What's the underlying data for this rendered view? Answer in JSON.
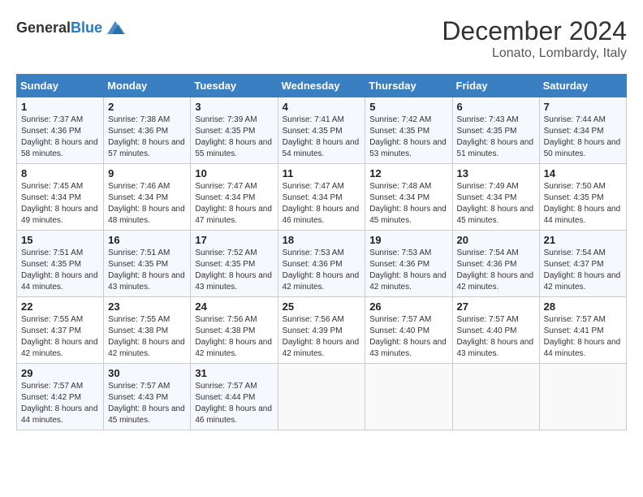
{
  "header": {
    "logo_general": "General",
    "logo_blue": "Blue",
    "month": "December 2024",
    "location": "Lonato, Lombardy, Italy"
  },
  "weekdays": [
    "Sunday",
    "Monday",
    "Tuesday",
    "Wednesday",
    "Thursday",
    "Friday",
    "Saturday"
  ],
  "weeks": [
    [
      {
        "day": "1",
        "sunrise": "7:37 AM",
        "sunset": "4:36 PM",
        "daylight": "8 hours and 58 minutes."
      },
      {
        "day": "2",
        "sunrise": "7:38 AM",
        "sunset": "4:36 PM",
        "daylight": "8 hours and 57 minutes."
      },
      {
        "day": "3",
        "sunrise": "7:39 AM",
        "sunset": "4:35 PM",
        "daylight": "8 hours and 55 minutes."
      },
      {
        "day": "4",
        "sunrise": "7:41 AM",
        "sunset": "4:35 PM",
        "daylight": "8 hours and 54 minutes."
      },
      {
        "day": "5",
        "sunrise": "7:42 AM",
        "sunset": "4:35 PM",
        "daylight": "8 hours and 53 minutes."
      },
      {
        "day": "6",
        "sunrise": "7:43 AM",
        "sunset": "4:35 PM",
        "daylight": "8 hours and 51 minutes."
      },
      {
        "day": "7",
        "sunrise": "7:44 AM",
        "sunset": "4:34 PM",
        "daylight": "8 hours and 50 minutes."
      }
    ],
    [
      {
        "day": "8",
        "sunrise": "7:45 AM",
        "sunset": "4:34 PM",
        "daylight": "8 hours and 49 minutes."
      },
      {
        "day": "9",
        "sunrise": "7:46 AM",
        "sunset": "4:34 PM",
        "daylight": "8 hours and 48 minutes."
      },
      {
        "day": "10",
        "sunrise": "7:47 AM",
        "sunset": "4:34 PM",
        "daylight": "8 hours and 47 minutes."
      },
      {
        "day": "11",
        "sunrise": "7:47 AM",
        "sunset": "4:34 PM",
        "daylight": "8 hours and 46 minutes."
      },
      {
        "day": "12",
        "sunrise": "7:48 AM",
        "sunset": "4:34 PM",
        "daylight": "8 hours and 45 minutes."
      },
      {
        "day": "13",
        "sunrise": "7:49 AM",
        "sunset": "4:34 PM",
        "daylight": "8 hours and 45 minutes."
      },
      {
        "day": "14",
        "sunrise": "7:50 AM",
        "sunset": "4:35 PM",
        "daylight": "8 hours and 44 minutes."
      }
    ],
    [
      {
        "day": "15",
        "sunrise": "7:51 AM",
        "sunset": "4:35 PM",
        "daylight": "8 hours and 44 minutes."
      },
      {
        "day": "16",
        "sunrise": "7:51 AM",
        "sunset": "4:35 PM",
        "daylight": "8 hours and 43 minutes."
      },
      {
        "day": "17",
        "sunrise": "7:52 AM",
        "sunset": "4:35 PM",
        "daylight": "8 hours and 43 minutes."
      },
      {
        "day": "18",
        "sunrise": "7:53 AM",
        "sunset": "4:36 PM",
        "daylight": "8 hours and 42 minutes."
      },
      {
        "day": "19",
        "sunrise": "7:53 AM",
        "sunset": "4:36 PM",
        "daylight": "8 hours and 42 minutes."
      },
      {
        "day": "20",
        "sunrise": "7:54 AM",
        "sunset": "4:36 PM",
        "daylight": "8 hours and 42 minutes."
      },
      {
        "day": "21",
        "sunrise": "7:54 AM",
        "sunset": "4:37 PM",
        "daylight": "8 hours and 42 minutes."
      }
    ],
    [
      {
        "day": "22",
        "sunrise": "7:55 AM",
        "sunset": "4:37 PM",
        "daylight": "8 hours and 42 minutes."
      },
      {
        "day": "23",
        "sunrise": "7:55 AM",
        "sunset": "4:38 PM",
        "daylight": "8 hours and 42 minutes."
      },
      {
        "day": "24",
        "sunrise": "7:56 AM",
        "sunset": "4:38 PM",
        "daylight": "8 hours and 42 minutes."
      },
      {
        "day": "25",
        "sunrise": "7:56 AM",
        "sunset": "4:39 PM",
        "daylight": "8 hours and 42 minutes."
      },
      {
        "day": "26",
        "sunrise": "7:57 AM",
        "sunset": "4:40 PM",
        "daylight": "8 hours and 43 minutes."
      },
      {
        "day": "27",
        "sunrise": "7:57 AM",
        "sunset": "4:40 PM",
        "daylight": "8 hours and 43 minutes."
      },
      {
        "day": "28",
        "sunrise": "7:57 AM",
        "sunset": "4:41 PM",
        "daylight": "8 hours and 44 minutes."
      }
    ],
    [
      {
        "day": "29",
        "sunrise": "7:57 AM",
        "sunset": "4:42 PM",
        "daylight": "8 hours and 44 minutes."
      },
      {
        "day": "30",
        "sunrise": "7:57 AM",
        "sunset": "4:43 PM",
        "daylight": "8 hours and 45 minutes."
      },
      {
        "day": "31",
        "sunrise": "7:57 AM",
        "sunset": "4:44 PM",
        "daylight": "8 hours and 46 minutes."
      },
      null,
      null,
      null,
      null
    ]
  ]
}
